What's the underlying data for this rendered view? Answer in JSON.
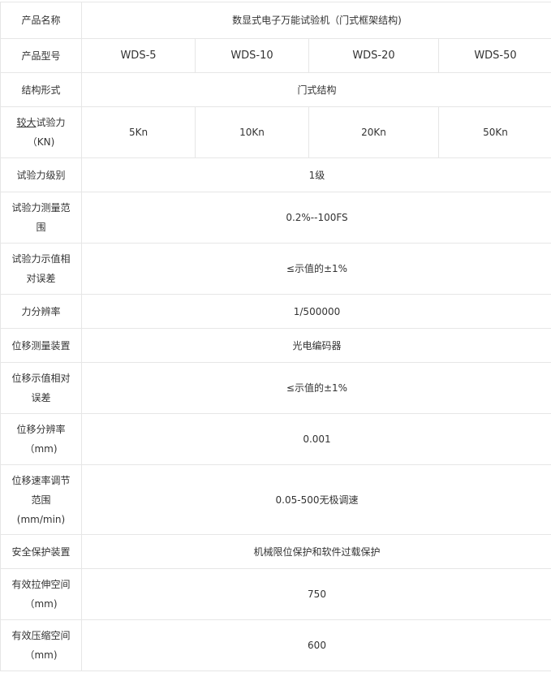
{
  "rows": [
    {
      "label": "产品名称",
      "value": "数显式电子万能试验机（门式框架结构)"
    },
    {
      "label": "产品型号",
      "values": [
        "WDS-5",
        "WDS-10",
        "WDS-20",
        "WDS-50"
      ]
    },
    {
      "label": "结构形式",
      "value": "门式结构"
    },
    {
      "label_u": "较大",
      "label_rest": "试验力",
      "label_sub": "（KN)",
      "values": [
        "5Kn",
        "10Kn",
        "20Kn",
        "50Kn"
      ]
    },
    {
      "label": "试验力级别",
      "value": "1级"
    },
    {
      "label": "试验力测量范围",
      "value": "0.2%--100FS"
    },
    {
      "label": "试验力示值相对误差",
      "value": "≤示值的±1%"
    },
    {
      "label": "力分辨率",
      "value": "1/500000"
    },
    {
      "label": "位移测量装置",
      "value": "光电编码器"
    },
    {
      "label": "位移示值相对误差",
      "value": "≤示值的±1%"
    },
    {
      "label": "位移分辨率",
      "label_sub": "（mm)",
      "value": "0.001"
    },
    {
      "label": "位移速率调节范围",
      "label_sub": "(mm/min)",
      "value": "0.05-500无极调速"
    },
    {
      "label": "安全保护装置",
      "value": "机械限位保护和软件过载保护"
    },
    {
      "label": "有效拉伸空间",
      "label_sub": "（mm)",
      "value": "750"
    },
    {
      "label": "有效压缩空间",
      "label_sub": "（mm)",
      "value": "600"
    }
  ]
}
